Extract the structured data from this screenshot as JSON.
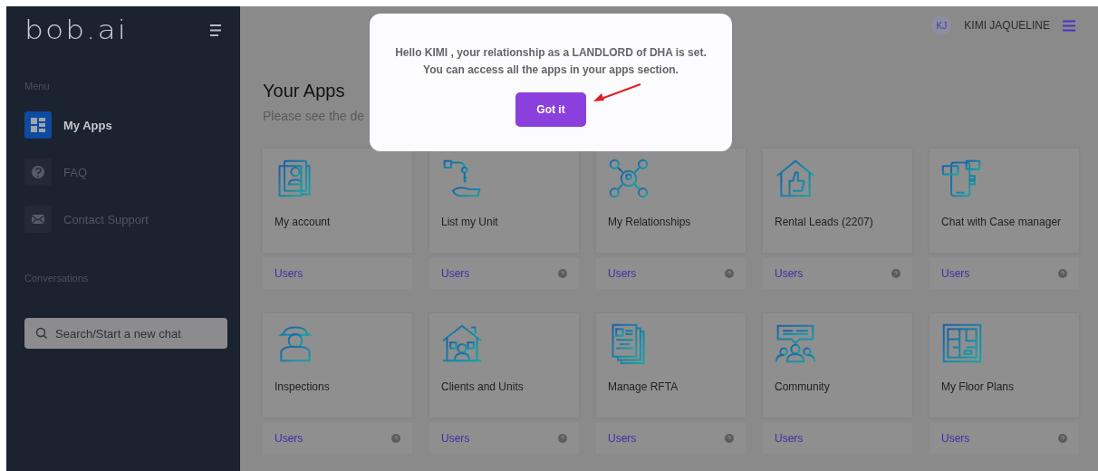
{
  "sidebar": {
    "logo": "bob.ai",
    "menu_label": "Menu",
    "items": [
      {
        "label": "My Apps",
        "selected": true
      },
      {
        "label": "FAQ",
        "selected": false
      },
      {
        "label": "Contact Support",
        "selected": false
      }
    ],
    "conversations_label": "Conversations",
    "search": {
      "placeholder": "Search/Start a new chat"
    }
  },
  "header": {
    "avatar": "KJ",
    "user_name": "KIMI JAQUELINE"
  },
  "page": {
    "title": "Your Apps",
    "subtitle": "Please see the de"
  },
  "apps": [
    {
      "title": "My account",
      "footer": "Users",
      "help": false
    },
    {
      "title": "List my Unit",
      "footer": "Users",
      "help": true
    },
    {
      "title": "My Relationships",
      "footer": "Users",
      "help": true
    },
    {
      "title": "Rental Leads (2207)",
      "footer": "Users",
      "help": true
    },
    {
      "title": "Chat with Case manager",
      "footer": "Users",
      "help": true
    },
    {
      "title": "Inspections",
      "footer": "Users",
      "help": true
    },
    {
      "title": "Clients and Units",
      "footer": "Users",
      "help": true
    },
    {
      "title": "Manage RFTA",
      "footer": "Users",
      "help": true
    },
    {
      "title": "Community",
      "footer": "Users",
      "help": false
    },
    {
      "title": "My Floor Plans",
      "footer": "Users",
      "help": true
    }
  ],
  "modal": {
    "lines": [
      "Hello KIMI , your relationship as a LANDLORD of DHA is set.",
      "You can access all the apps in your apps section."
    ],
    "button": "Got it"
  }
}
